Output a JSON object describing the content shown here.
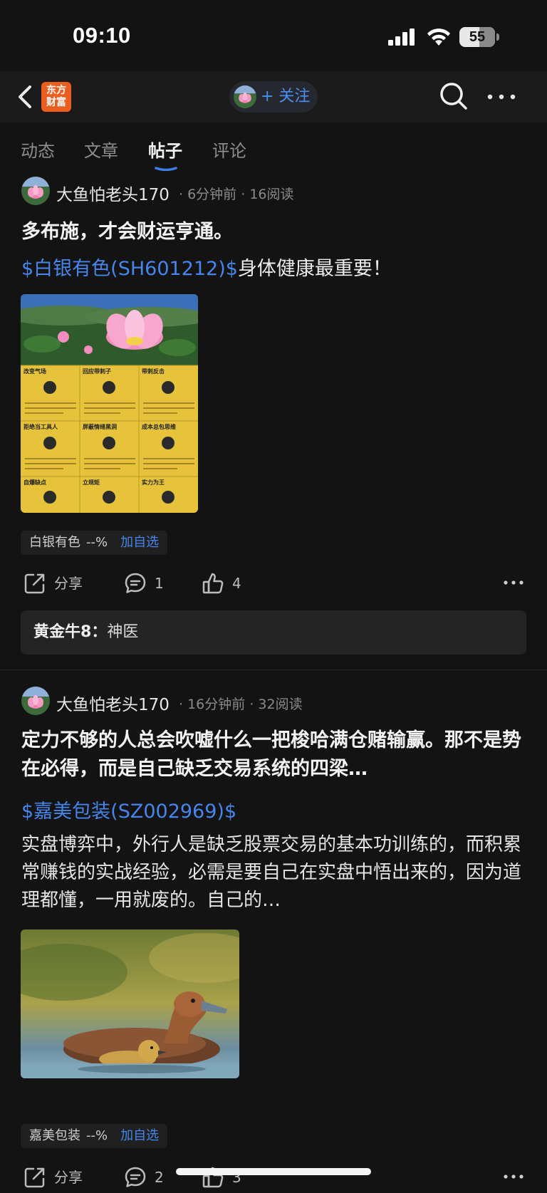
{
  "status": {
    "time": "09:10",
    "battery": "55"
  },
  "nav": {
    "logo_line1": "东方",
    "logo_line2": "财富",
    "follow_label": "+ 关注"
  },
  "tabs": [
    "动态",
    "文章",
    "帖子",
    "评论"
  ],
  "active_tab": "帖子",
  "posts": [
    {
      "author": "大鱼怕老头170",
      "time": "6分钟前",
      "reads": "16阅读",
      "title": "多布施，才会财运亨通。",
      "stock_tag": "$白银有色(SH601212)$",
      "stock_suffix": "身体健康最重要！",
      "chip": {
        "name": "白银有色",
        "pct": "--%",
        "add": "加自选"
      },
      "share_label": "分享",
      "comments": "1",
      "likes": "4",
      "comment_preview": {
        "user": "黄金牛8：",
        "text": "神医"
      }
    },
    {
      "author": "大鱼怕老头170",
      "time": "16分钟前",
      "reads": "32阅读",
      "title": "定力不够的人总会吹嘘什么一把梭哈满仓赌输赢。那不是势在必得，而是自己缺乏交易系统的四梁…",
      "stock_tag": "$嘉美包装(SZ002969)$",
      "body": "实盘博弈中，外行人是缺乏股票交易的基本功训练的，而积累常赚钱的实战经验，必需是要自己在实盘中悟出来的，因为道理都懂，一用就废的。自己的…",
      "chip": {
        "name": "嘉美包装",
        "pct": "--%",
        "add": "加自选"
      },
      "share_label": "分享",
      "comments": "2",
      "likes": "3"
    }
  ],
  "infographic": {
    "cells": [
      "改变气场",
      "回应带刺子",
      "带刺反击",
      "拒绝当工具人",
      "屏蔽情绪黑洞",
      "成本总包思维",
      "自爆缺点",
      "立规矩",
      "实力为王"
    ]
  },
  "colors": {
    "background": "#131313",
    "link": "#4686ec",
    "logo": "#ec5d20",
    "infographic": "#e7c33c"
  },
  "icons": [
    "back-icon",
    "search-icon",
    "more-icon",
    "share-icon",
    "comment-icon",
    "like-icon"
  ]
}
